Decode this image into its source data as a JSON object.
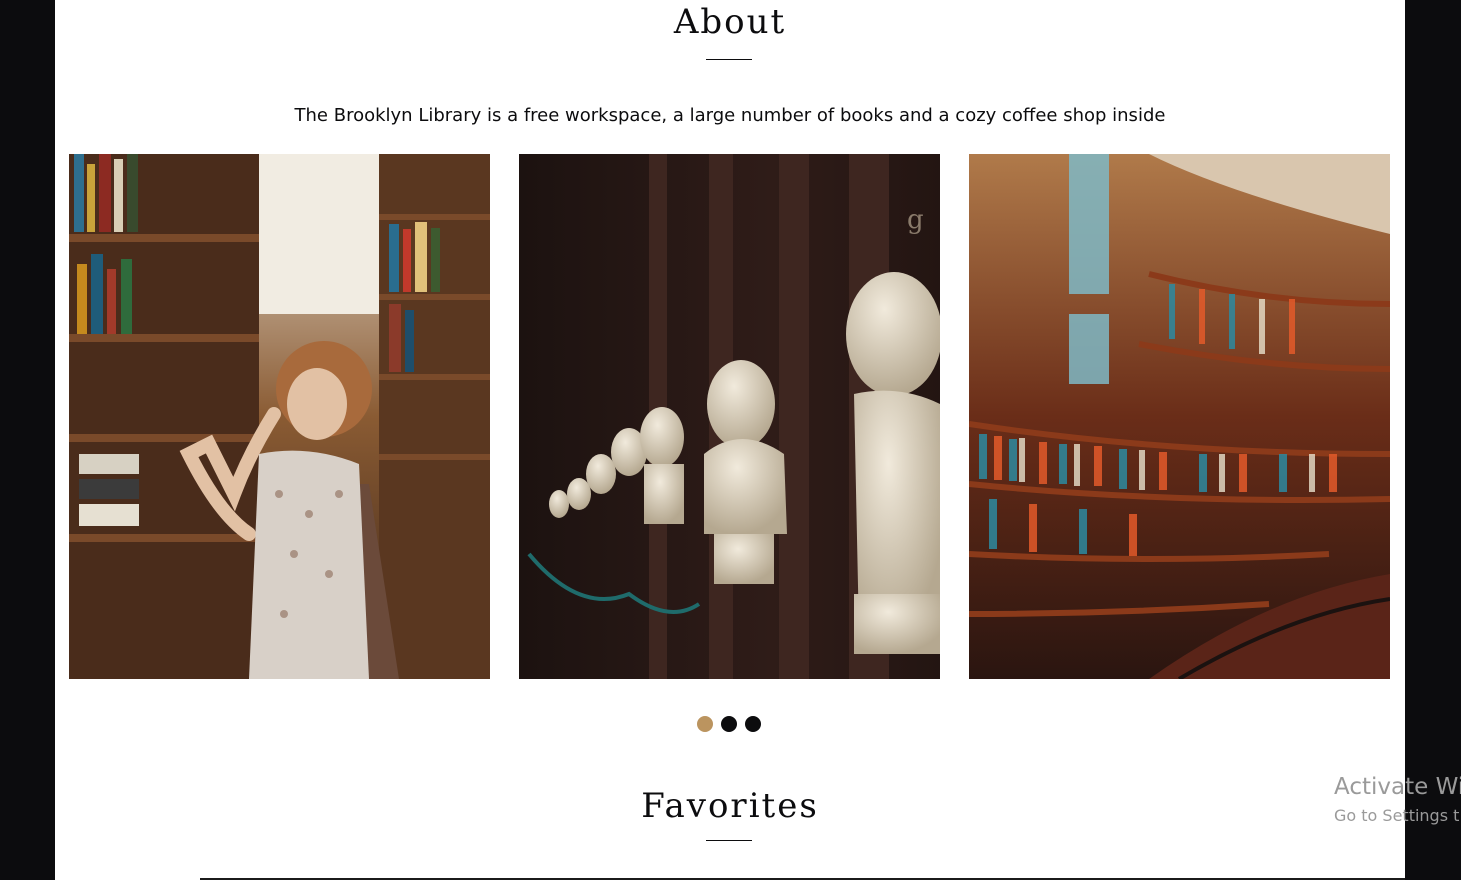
{
  "about": {
    "title": "About",
    "description": "The Brooklyn Library is a free workspace, a large number of books and a cozy coffee shop inside"
  },
  "carousel": {
    "active_index": 0,
    "dot_count": 3,
    "active_color": "#bb945f",
    "inactive_color": "#0c0c0e"
  },
  "favorites": {
    "title": "Favorites"
  },
  "watermark": {
    "title": "Activate Wi",
    "subtitle": "Go to Settings t"
  }
}
